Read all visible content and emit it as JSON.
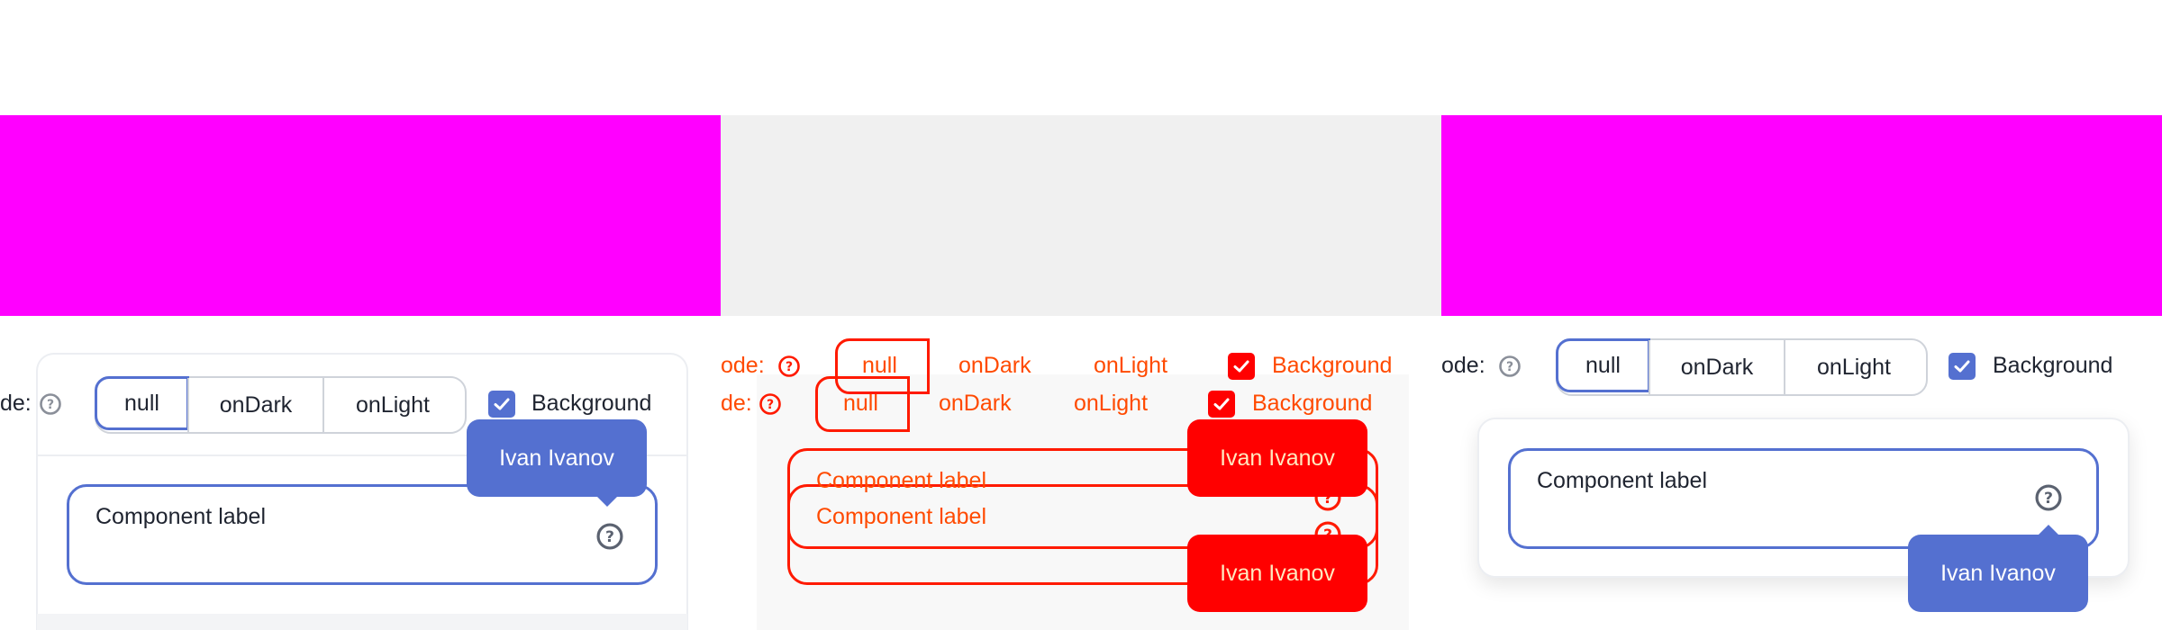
{
  "theme": {
    "accent": "#5470d0",
    "band_magenta": "#ff00ff",
    "band_gray": "#f0f0f0",
    "diff_red": "#ff0000"
  },
  "controls": {
    "mode_label": "Mode:",
    "mode_label_cropped_left": "de:",
    "mode_label_cropped_mid": "ode:",
    "mode_options": [
      "null",
      "onDark",
      "onLight"
    ],
    "selected_mode": "null",
    "background_label": "Background",
    "background_checked": true
  },
  "component": {
    "label": "Component label",
    "tooltip_text": "Ivan Ivanov",
    "help_icon": "question-circle-icon"
  }
}
